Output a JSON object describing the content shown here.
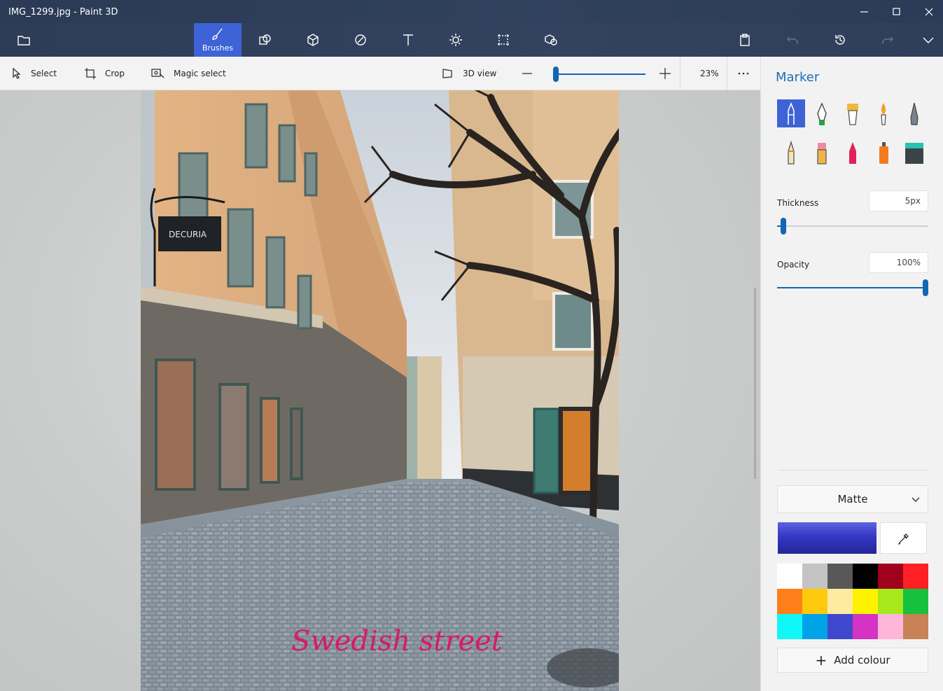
{
  "window": {
    "title": "IMG_1299.jpg - Paint 3D"
  },
  "ribbon": {
    "active_tab": "Brushes",
    "tabs": [
      "Menu",
      "Brushes",
      "2D shapes",
      "3D shapes",
      "Stickers",
      "Text",
      "Effects",
      "Canvas",
      "3D library"
    ],
    "right_buttons": [
      "Paste",
      "Undo",
      "History",
      "Redo",
      "Expand"
    ]
  },
  "toolbar": {
    "select_label": "Select",
    "crop_label": "Crop",
    "magic_select_label": "Magic select",
    "view3d_label": "3D view",
    "zoom_value": "23%",
    "zoom_percent": 23
  },
  "canvas": {
    "sign_text": "DECURIA",
    "overlay_text": "Swedish street",
    "overlay_color": "#d81b60"
  },
  "panel": {
    "title": "Marker",
    "brushes": [
      {
        "name": "Marker",
        "selected": true
      },
      {
        "name": "Calligraphy pen",
        "selected": false
      },
      {
        "name": "Oil brush",
        "selected": false
      },
      {
        "name": "Watercolor",
        "selected": false
      },
      {
        "name": "Pixel pen",
        "selected": false
      },
      {
        "name": "Pencil",
        "selected": false
      },
      {
        "name": "Eraser",
        "selected": false
      },
      {
        "name": "Crayon",
        "selected": false
      },
      {
        "name": "Spray can",
        "selected": false
      },
      {
        "name": "Fill",
        "selected": false
      }
    ],
    "thickness_label": "Thickness",
    "thickness_value": "5px",
    "thickness_level": 0.04,
    "opacity_label": "Opacity",
    "opacity_value": "100%",
    "opacity_level": 1.0,
    "finish_value": "Matte",
    "current_color": "#3438c4",
    "palette": [
      "#ffffff",
      "#c3c3c3",
      "#585858",
      "#000000",
      "#a0001c",
      "#ff1f25",
      "#ff7f1a",
      "#ffc90e",
      "#ffeaa2",
      "#fff200",
      "#a7e81c",
      "#16c13d",
      "#10f7f7",
      "#00a2e8",
      "#3f48cc",
      "#d433c4",
      "#ffb6d9",
      "#c98156"
    ],
    "add_colour_label": "Add colour"
  }
}
